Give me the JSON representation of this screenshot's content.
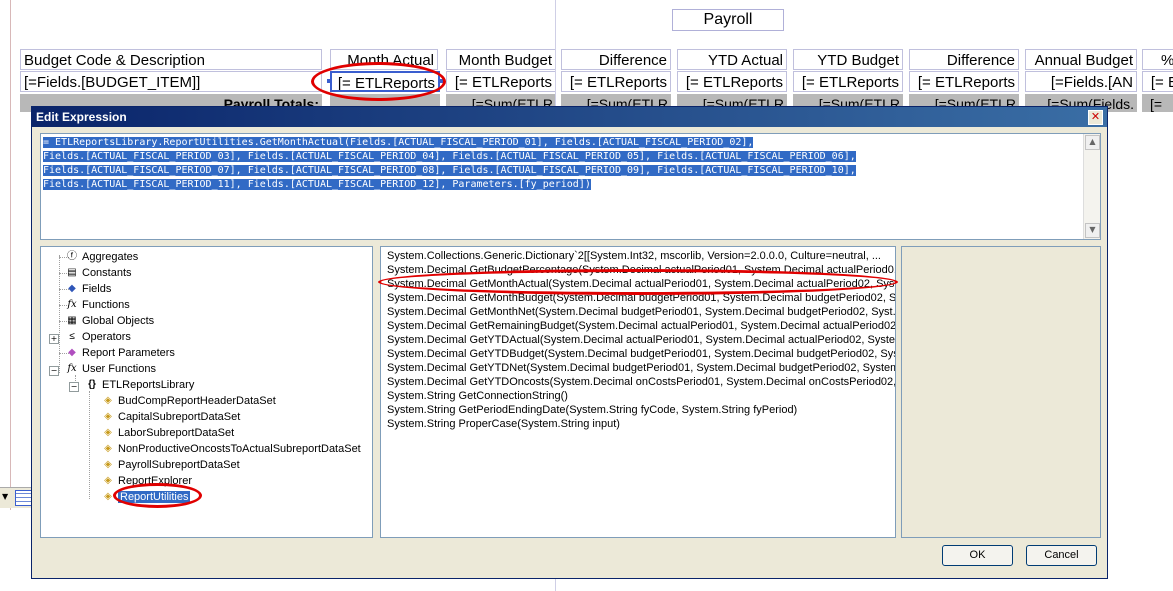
{
  "report": {
    "title": "Payroll",
    "columns": [
      "Budget Code & Description",
      "Month Actual",
      "Month Budget",
      "Difference",
      "YTD Actual",
      "YTD Budget",
      "Difference",
      "Annual Budget",
      "%"
    ],
    "detail_row": [
      "[=Fields.[BUDGET_ITEM]]",
      "[= ETLReports",
      "[= ETLReports",
      "[= ETLReports",
      "[= ETLReports",
      "[= ETLReports",
      "[= ETLReports",
      "[=Fields.[AN",
      "[= E"
    ],
    "totals_label": "Payroll Totals:",
    "totals_row": [
      "[=Sum(ETLR",
      "[=Sum(ETLR",
      "[=Sum(ETLR",
      "[=Sum(ETLR",
      "[=Sum(ETLR",
      "[=Sum(Fields.",
      "[="
    ]
  },
  "dialog": {
    "title": "Edit Expression",
    "expression_lines": [
      "= ETLReportsLibrary.ReportUtilities.GetMonthActual(Fields.[ACTUAL_FISCAL_PERIOD_01], Fields.[ACTUAL_FISCAL_PERIOD_02],",
      "Fields.[ACTUAL_FISCAL_PERIOD_03], Fields.[ACTUAL_FISCAL_PERIOD_04], Fields.[ACTUAL_FISCAL_PERIOD_05], Fields.[ACTUAL_FISCAL_PERIOD_06],",
      "Fields.[ACTUAL_FISCAL_PERIOD_07], Fields.[ACTUAL_FISCAL_PERIOD_08], Fields.[ACTUAL_FISCAL_PERIOD_09], Fields.[ACTUAL_FISCAL_PERIOD_10],",
      "Fields.[ACTUAL_FISCAL_PERIOD_11], Fields.[ACTUAL_FISCAL_PERIOD_12], Parameters.[fy_period])"
    ],
    "tree": {
      "aggregates": "Aggregates",
      "constants": "Constants",
      "fields": "Fields",
      "functions": "Functions",
      "global_objects": "Global Objects",
      "operators": "Operators",
      "report_parameters": "Report Parameters",
      "user_functions": "User Functions",
      "library": "ETLReportsLibrary",
      "classes": [
        "BudCompReportHeaderDataSet",
        "CapitalSubreportDataSet",
        "LaborSubreportDataSet",
        "NonProductiveOncostsToActualSubreportDataSet",
        "PayrollSubreportDataSet",
        "ReportExplorer",
        "ReportUtilities"
      ]
    },
    "functions": [
      "System.Collections.Generic.Dictionary`2[[System.Int32, mscorlib, Version=2.0.0.0, Culture=neutral, ...",
      "System.Decimal GetBudgetPercentage(System.Decimal actualPeriod01, System.Decimal actualPeriod0...",
      "System.Decimal GetMonthActual(System.Decimal actualPeriod01, System.Decimal actualPeriod02, Syst...",
      "System.Decimal GetMonthBudget(System.Decimal budgetPeriod01, System.Decimal budgetPeriod02, Sys...",
      "System.Decimal GetMonthNet(System.Decimal budgetPeriod01, System.Decimal budgetPeriod02, Syst...",
      "System.Decimal GetRemainingBudget(System.Decimal actualPeriod01, System.Decimal actualPeriod02,...",
      "System.Decimal GetYTDActual(System.Decimal actualPeriod01, System.Decimal actualPeriod02, Syste...",
      "System.Decimal GetYTDBudget(System.Decimal budgetPeriod01, System.Decimal budgetPeriod02, Sys...",
      "System.Decimal GetYTDNet(System.Decimal budgetPeriod01, System.Decimal budgetPeriod02, System...",
      "System.Decimal GetYTDOncosts(System.Decimal onCostsPeriod01, System.Decimal onCostsPeriod02, ...",
      "System.String GetConnectionString()",
      "System.String GetPeriodEndingDate(System.String fyCode, System.String fyPeriod)",
      "System.String ProperCase(System.String input)"
    ],
    "ok_label": "OK",
    "cancel_label": "Cancel"
  },
  "colors": {
    "selection": "#316ac5",
    "highlight_ring": "#e00000",
    "titlebar": "#0a246a"
  }
}
